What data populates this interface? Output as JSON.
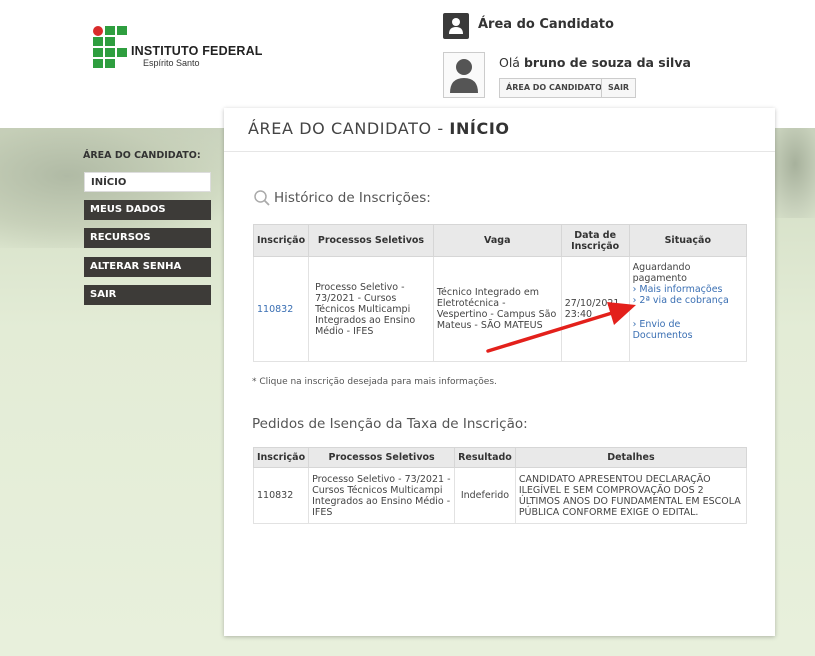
{
  "header": {
    "logo": {
      "line1": "INSTITUTO FEDERAL",
      "line2": "Espírito Santo"
    },
    "area_title": "Área do Candidato",
    "greeting_prefix": "Olá ",
    "user_name": "bruno de souza da silva",
    "area_button": "ÁREA DO CANDIDATO",
    "logout_button": "SAIR"
  },
  "sidebar": {
    "title": "ÁREA DO CANDIDATO:",
    "items": [
      {
        "label": "INÍCIO",
        "active": true
      },
      {
        "label": "MEUS DADOS",
        "active": false
      },
      {
        "label": "RECURSOS",
        "active": false
      },
      {
        "label": "ALTERAR SENHA",
        "active": false
      },
      {
        "label": "SAIR",
        "active": false
      }
    ]
  },
  "main": {
    "title_prefix": "ÁREA DO CANDIDATO - ",
    "title_bold": "INÍCIO",
    "history": {
      "title": "Histórico de Inscrições:",
      "headers": [
        "Inscrição",
        "Processos Seletivos",
        "Vaga",
        "Data de Inscrição",
        "Situação"
      ],
      "row": {
        "inscricao": "110832",
        "processo": "Processo Seletivo - 73/2021 - Cursos Técnicos Multicampi Integrados ao Ensino Médio - IFES",
        "vaga": "Técnico Integrado em Eletrotécnica - Vespertino - Campus São Mateus - SÃO MATEUS",
        "data": "27/10/2021 23:40",
        "situacao_status": "Aguardando pagamento",
        "link_mais": "› Mais informações",
        "link_cobranca": "› 2ª via de cobrança",
        "link_envio": "› Envio de Documentos"
      }
    },
    "note": "* Clique na inscrição desejada para mais informações.",
    "exemption": {
      "title": "Pedidos de Isenção da Taxa de Inscrição:",
      "headers": [
        "Inscrição",
        "Processos Seletivos",
        "Resultado",
        "Detalhes"
      ],
      "row": {
        "inscricao": "110832",
        "processo": "Processo Seletivo - 73/2021 - Cursos Técnicos Multicampi Integrados ao Ensino Médio - IFES",
        "resultado": "Indeferido",
        "detalhes": "CANDIDATO APRESENTOU DECLARAÇÃO ILEGÍVEL E SEM COMPROVAÇÃO DOS 2 ÚLTIMOS ANOS DO FUNDAMENTAL EM ESCOLA PÚBLICA CONFORME EXIGE O EDITAL."
      }
    }
  },
  "colors": {
    "logo_green": "#2e9e3f",
    "logo_red": "#d92b2b",
    "sidebar_dark": "#3d3b38",
    "link_blue": "#3a6fb3",
    "annotation_arrow": "#e3201b"
  },
  "icons": [
    "user-silhouette-icon",
    "avatar-placeholder-icon",
    "search-icon",
    "red-arrow-annotation"
  ]
}
